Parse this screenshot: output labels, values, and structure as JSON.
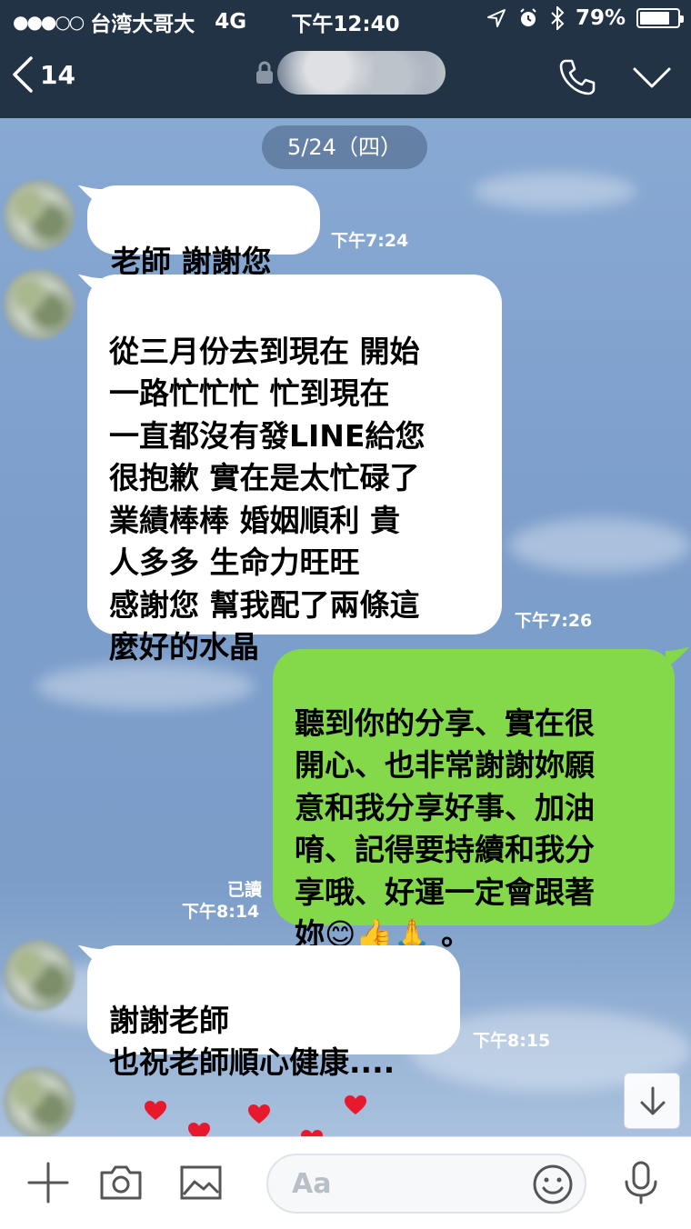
{
  "status_bar": {
    "signal": "●●●○○",
    "carrier": "台湾大哥大",
    "network": "4G",
    "time": "下午12:40",
    "battery": "79%",
    "battery_level": 0.79
  },
  "header": {
    "back_count": "14"
  },
  "chat": {
    "date": "5/24（四）",
    "messages": [
      {
        "dir": "in",
        "text": "老師 謝謝您",
        "time": "下午7:24"
      },
      {
        "dir": "in",
        "text": "從三月份去到現在 開始\n一路忙忙忙 忙到現在\n一直都沒有發LINE給您\n很抱歉 實在是太忙碌了\n業績棒棒 婚姻順利  貴\n人多多 生命力旺旺\n感謝您 幫我配了兩條這\n麼好的水晶",
        "time": "下午7:26"
      },
      {
        "dir": "out",
        "text": "聽到你的分享、實在很\n開心、也非常謝謝妳願\n意和我分享好事、加油\n唷、記得要持續和我分\n享哦、好運一定會跟著\n妳😊👍🙏 。",
        "read": "已讀",
        "time": "下午8:14"
      },
      {
        "dir": "in",
        "text": "謝謝老師\n也祝老師順心健康....",
        "time": "下午8:15"
      }
    ]
  },
  "input": {
    "placeholder": "Aa"
  },
  "colors": {
    "header_bg": "#223345",
    "outgoing_bubble": "#84d94b",
    "incoming_bubble": "#ffffff",
    "chat_bg": "#7fa2cf",
    "heart": "#e8192c"
  }
}
